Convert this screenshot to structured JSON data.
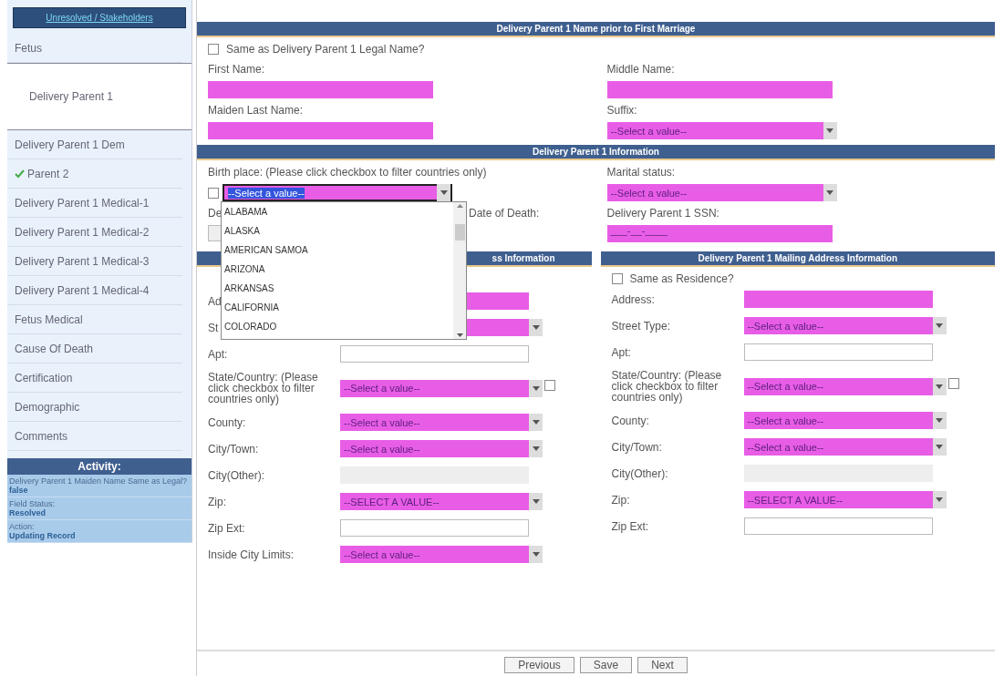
{
  "sidebar": {
    "top_link": "Unresolved / Stakeholders",
    "items": [
      {
        "label": "Fetus",
        "selected": false,
        "complete": false
      },
      {
        "label": "Delivery Parent 1",
        "selected": true,
        "complete": false
      },
      {
        "label": "Delivery Parent 1 Dem",
        "selected": false,
        "complete": false
      },
      {
        "label": "Parent 2",
        "selected": false,
        "complete": true
      },
      {
        "label": "Delivery Parent 1 Medical-1",
        "selected": false,
        "complete": false
      },
      {
        "label": "Delivery Parent 1 Medical-2",
        "selected": false,
        "complete": false
      },
      {
        "label": "Delivery Parent 1 Medical-3",
        "selected": false,
        "complete": false
      },
      {
        "label": "Delivery Parent 1 Medical-4",
        "selected": false,
        "complete": false
      },
      {
        "label": "Fetus Medical",
        "selected": false,
        "complete": false
      },
      {
        "label": "Cause Of Death",
        "selected": false,
        "complete": false
      },
      {
        "label": "Certification",
        "selected": false,
        "complete": false
      },
      {
        "label": "Demographic",
        "selected": false,
        "complete": false
      },
      {
        "label": "Comments",
        "selected": false,
        "complete": false
      }
    ]
  },
  "activity": {
    "title": "Activity:",
    "entries": [
      {
        "label": "Delivery Parent 1 Maiden Name Same as Legal?",
        "value": "false"
      },
      {
        "label": "Field Status:",
        "value": "Resolved"
      },
      {
        "label": "Action:",
        "value": "Updating Record"
      }
    ]
  },
  "name_section": {
    "title": "Delivery Parent 1 Name prior to First Marriage",
    "same_as": {
      "label": "Same as Delivery Parent 1 Legal Name?",
      "checked": false
    },
    "fields": [
      {
        "label": "First Name:",
        "kind": "text"
      },
      {
        "label": "Middle Name:",
        "kind": "text"
      },
      {
        "label": "Maiden Last Name:",
        "kind": "text"
      },
      {
        "label": "Suffix:",
        "kind": "select",
        "value": "--Select a value--"
      }
    ]
  },
  "info_section": {
    "title": "Delivery Parent 1 Information",
    "birth_place": {
      "label": "Birth place: (Please click checkbox to filter countries only)",
      "filter_checked": false,
      "value": "--Select a value--",
      "open": true,
      "options": [
        "ALABAMA",
        "ALASKA",
        "AMERICAN SAMOA",
        "ARIZONA",
        "ARKANSAS",
        "CALIFORNIA",
        "COLORADO"
      ]
    },
    "marital_status": {
      "label": "Marital status:",
      "value": "--Select a value--"
    },
    "partial_label": "De",
    "death_date_label": "Date of Death:",
    "ssn": {
      "label": "Delivery Parent 1 SSN:",
      "value": "___-__-____"
    }
  },
  "residence_section": {
    "title": "ss Information",
    "fields": [
      {
        "label": "Ad",
        "kind": "text"
      },
      {
        "label": "St",
        "kind": "select"
      },
      {
        "label": "Apt:",
        "kind": "plain"
      },
      {
        "label": "State/Country: (Please click checkbox to filter countries only)",
        "kind": "select",
        "value": "--Select a value--",
        "filter_checked": false
      },
      {
        "label": "County:",
        "kind": "select",
        "value": "--Select a value--"
      },
      {
        "label": "City/Town:",
        "kind": "select",
        "value": "--Select a value--"
      },
      {
        "label": "City(Other):",
        "kind": "disabled"
      },
      {
        "label": "Zip:",
        "kind": "select",
        "value": "--SELECT A VALUE--"
      },
      {
        "label": "Zip Ext:",
        "kind": "plain"
      },
      {
        "label": "Inside City Limits:",
        "kind": "select",
        "value": "--Select a value--"
      }
    ]
  },
  "mailing_section": {
    "title": "Delivery Parent 1 Mailing Address Information",
    "same_as": {
      "label": "Same as Residence?",
      "checked": false
    },
    "fields": [
      {
        "label": "Address:",
        "kind": "text"
      },
      {
        "label": "Street Type:",
        "kind": "select",
        "value": "--Select a value--"
      },
      {
        "label": "Apt:",
        "kind": "plain"
      },
      {
        "label": "State/Country: (Please click checkbox to filter countries only)",
        "kind": "select",
        "value": "--Select a value--",
        "filter_checked": false
      },
      {
        "label": "County:",
        "kind": "select",
        "value": "--Select a value--"
      },
      {
        "label": "City/Town:",
        "kind": "select",
        "value": "--Select a value--"
      },
      {
        "label": "City(Other):",
        "kind": "disabled"
      },
      {
        "label": "Zip:",
        "kind": "select",
        "value": "--SELECT A VALUE--"
      },
      {
        "label": "Zip Ext:",
        "kind": "plain"
      }
    ]
  },
  "buttons": [
    "Previous",
    "Save",
    "Next"
  ]
}
